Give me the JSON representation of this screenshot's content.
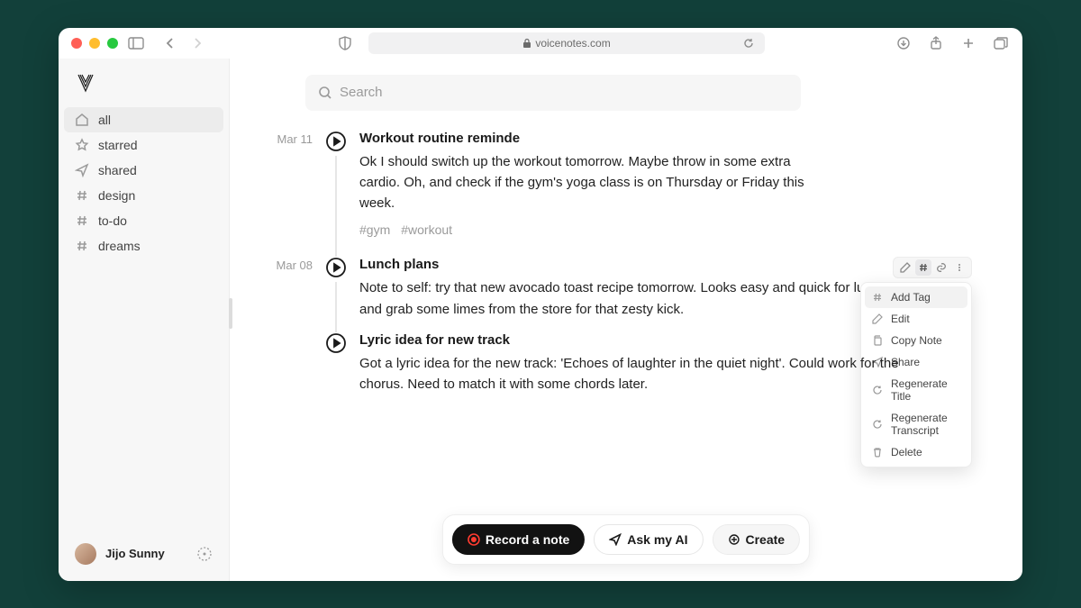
{
  "browser": {
    "url": "voicenotes.com"
  },
  "search": {
    "placeholder": "Search"
  },
  "sidebar": {
    "items": [
      {
        "label": "all",
        "icon": "home",
        "active": true
      },
      {
        "label": "starred",
        "icon": "star",
        "active": false
      },
      {
        "label": "shared",
        "icon": "send",
        "active": false
      },
      {
        "label": "design",
        "icon": "hash",
        "active": false
      },
      {
        "label": "to-do",
        "icon": "hash",
        "active": false
      },
      {
        "label": "dreams",
        "icon": "hash",
        "active": false
      }
    ]
  },
  "user": {
    "name": "Jijo Sunny"
  },
  "notes": [
    {
      "date": "Mar 11",
      "title": "Workout routine reminde",
      "body": "Ok I should switch up the workout tomorrow. Maybe throw in some extra cardio. Oh, and check if the gym's yoga class is on Thursday or Friday this week.",
      "tags": [
        "#gym",
        "#workout"
      ]
    },
    {
      "date": "Mar 08",
      "title": "Lunch plans",
      "body": "Note to self: try that new avocado toast recipe tomorrow. Looks easy and quick for lunch. Oh, and grab some limes from the store for that zesty kick."
    },
    {
      "date": "",
      "title": "Lyric idea for new track",
      "body": "Got a lyric idea for the new track: 'Echoes of laughter in the quiet night'. Could work for the chorus. Need to match it with some chords later."
    }
  ],
  "context_menu": {
    "items": [
      {
        "label": "Add Tag",
        "icon": "hash"
      },
      {
        "label": "Edit",
        "icon": "pencil"
      },
      {
        "label": "Copy Note",
        "icon": "copy"
      },
      {
        "label": "Share",
        "icon": "send"
      },
      {
        "label": "Regenerate Title",
        "icon": "refresh"
      },
      {
        "label": "Regenerate Transcript",
        "icon": "refresh"
      },
      {
        "label": "Delete",
        "icon": "trash"
      }
    ]
  },
  "actions": {
    "record": "Record a note",
    "ask": "Ask my AI",
    "create": "Create"
  }
}
